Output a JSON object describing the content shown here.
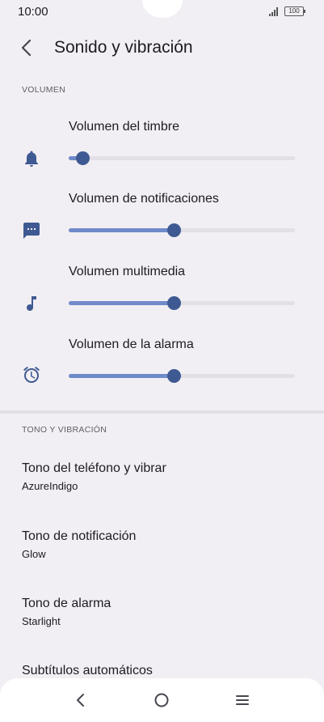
{
  "status_bar": {
    "time": "10:00",
    "battery": "100"
  },
  "header": {
    "title": "Sonido y vibración"
  },
  "volume_section": {
    "label": "VOLUMEN",
    "sliders": [
      {
        "label": "Volumen del timbre",
        "icon": "bell-icon",
        "level": 0.06
      },
      {
        "label": "Volumen de notificaciones",
        "icon": "chat-icon",
        "level": 0.466
      },
      {
        "label": "Volumen multimedia",
        "icon": "music-note-icon",
        "level": 0.466
      },
      {
        "label": "Volumen de la alarma",
        "icon": "alarm-icon",
        "level": 0.466
      }
    ]
  },
  "tone_section": {
    "label": "TONO Y VIBRACIÓN",
    "items": [
      {
        "title": "Tono del teléfono y vibrar",
        "subtitle": "AzureIndigo"
      },
      {
        "title": "Tono de notificación",
        "subtitle": "Glow"
      },
      {
        "title": "Tono de alarma",
        "subtitle": "Starlight"
      },
      {
        "title": "Subtítulos automáticos"
      }
    ]
  },
  "colors": {
    "background": "#f2eff4",
    "slider_fill": "#6f8ac9",
    "slider_thumb": "#3f5a92",
    "icon": "#3f5a92"
  }
}
